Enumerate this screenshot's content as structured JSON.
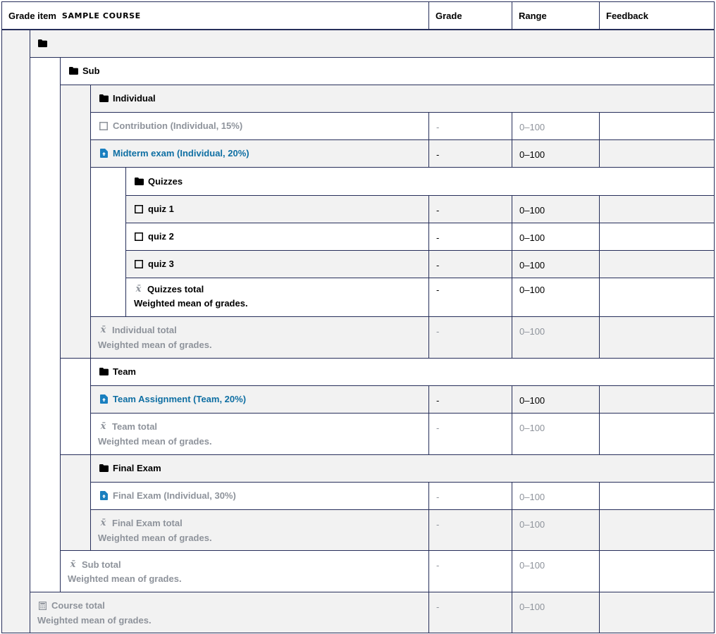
{
  "header": {
    "grade_item": "Grade item",
    "course_name": "SAMPLE COURSE",
    "grade": "Grade",
    "range": "Range",
    "feedback": "Feedback"
  },
  "rows": {
    "root_category": {
      "label": ""
    },
    "sub_category": {
      "label": "Sub"
    },
    "individual_category": {
      "label": "Individual"
    },
    "contribution": {
      "label": "Contribution (Individual, 15%)",
      "grade": "-",
      "range": "0–100"
    },
    "midterm": {
      "label": "Midterm exam (Individual, 20%)",
      "grade": "-",
      "range": "0–100"
    },
    "quizzes_category": {
      "label": "Quizzes"
    },
    "quiz1": {
      "label": "quiz 1",
      "grade": "-",
      "range": "0–100"
    },
    "quiz2": {
      "label": "quiz 2",
      "grade": "-",
      "range": "0–100"
    },
    "quiz3": {
      "label": "quiz 3",
      "grade": "-",
      "range": "0–100"
    },
    "quizzes_total": {
      "label": "Quizzes total",
      "desc": "Weighted mean of grades.",
      "grade": "-",
      "range": "0–100"
    },
    "individual_total": {
      "label": "Individual total",
      "desc": "Weighted mean of grades.",
      "grade": "-",
      "range": "0–100"
    },
    "team_category": {
      "label": "Team"
    },
    "team_assignment": {
      "label": "Team Assignment (Team, 20%)",
      "grade": "-",
      "range": "0–100"
    },
    "team_total": {
      "label": "Team total",
      "desc": "Weighted mean of grades.",
      "grade": "-",
      "range": "0–100"
    },
    "final_category": {
      "label": "Final Exam"
    },
    "final_exam": {
      "label": "Final Exam (Individual, 30%)",
      "grade": "-",
      "range": "0–100"
    },
    "final_total": {
      "label": "Final Exam total",
      "desc": "Weighted mean of grades.",
      "grade": "-",
      "range": "0–100"
    },
    "sub_total": {
      "label": "Sub total",
      "desc": "Weighted mean of grades.",
      "grade": "-",
      "range": "0–100"
    },
    "course_total": {
      "label": "Course total",
      "desc": "Weighted mean of grades.",
      "grade": "-",
      "range": "0–100"
    }
  },
  "icons": {
    "folder": "folder-icon",
    "checkbox": "manual-item-icon",
    "assignment": "assignment-icon",
    "mean": "mean-icon",
    "calculator": "calculator-icon"
  },
  "colors": {
    "border": "#262e5a",
    "shade": "#f2f2f2",
    "muted": "#8e939b",
    "link": "#0f6fa3"
  }
}
